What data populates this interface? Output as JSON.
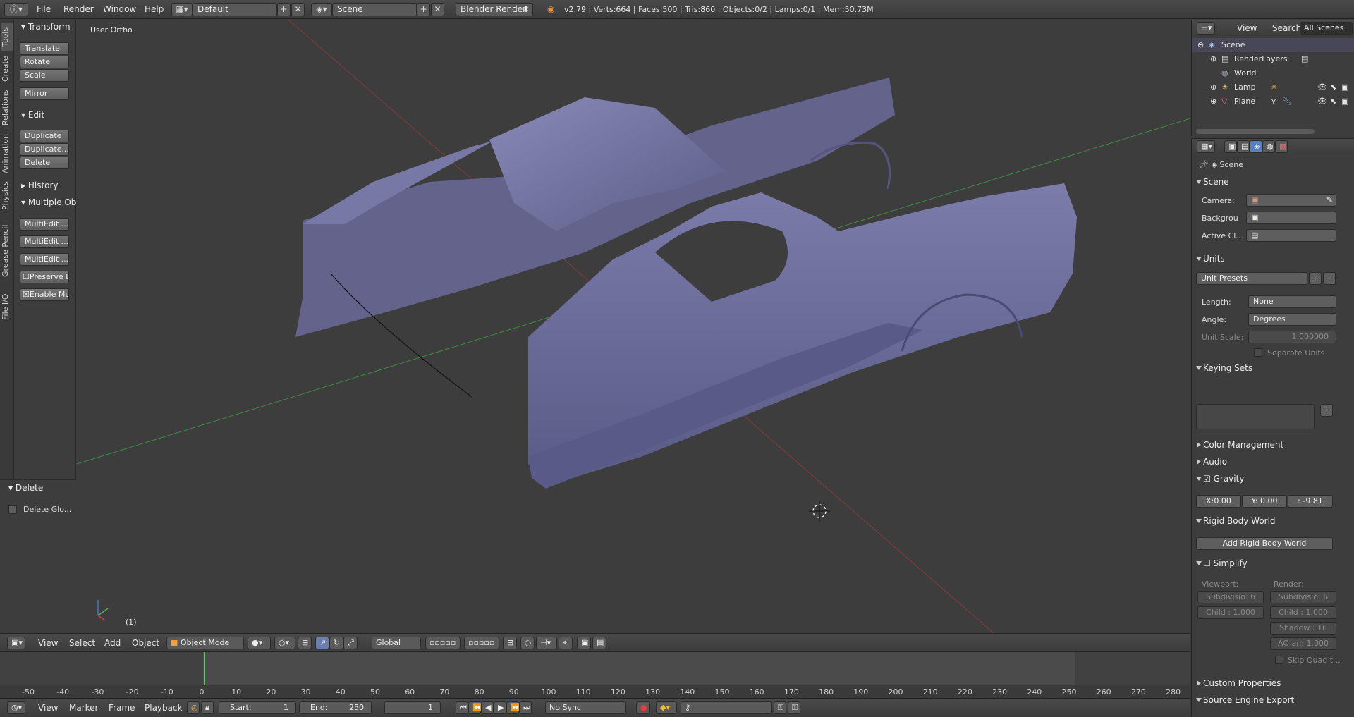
{
  "topbar": {
    "menus": [
      "File",
      "Render",
      "Window",
      "Help"
    ],
    "screen_layout": "Default",
    "scene": "Scene",
    "render_engine": "Blender Render",
    "stats": "v2.79 | Verts:664 | Faces:500 | Tris:860 | Objects:0/2 | Lamps:0/1 | Mem:50.73M"
  },
  "tool_tabs": [
    "Tools",
    "Create",
    "Relations",
    "Animation",
    "Physics",
    "Grease Pencil",
    "File I/O"
  ],
  "toolshelf": {
    "transform_title": "Transform",
    "transform_buttons": [
      "Translate",
      "Rotate",
      "Scale",
      "Mirror"
    ],
    "edit_title": "Edit",
    "edit_buttons": [
      "Duplicate",
      "Duplicate...",
      "Delete"
    ],
    "history_title": "History",
    "multi_title": "Multiple.Ob",
    "multi_buttons": [
      "MultiEdit ...",
      "MultiEdit ...",
      "MultiEdit ..."
    ],
    "preserve_label": "Preserve L",
    "enable_label": "Enable Mu"
  },
  "operator": {
    "title": "Delete",
    "option": "Delete Glo..."
  },
  "viewport": {
    "view_name": "User Ortho",
    "frame_label": "(1)"
  },
  "view3d_header": {
    "menus": [
      "View",
      "Select",
      "Add",
      "Object"
    ],
    "mode": "Object Mode",
    "orientation": "Global"
  },
  "timeline": {
    "ticks": [
      "-50",
      "-40",
      "-30",
      "-20",
      "-10",
      "0",
      "10",
      "20",
      "30",
      "40",
      "50",
      "60",
      "70",
      "80",
      "90",
      "100",
      "110",
      "120",
      "130",
      "140",
      "150",
      "160",
      "170",
      "180",
      "190",
      "200",
      "210",
      "220",
      "230",
      "240",
      "250",
      "260",
      "270",
      "280"
    ],
    "menus": [
      "View",
      "Marker",
      "Frame",
      "Playback"
    ],
    "start_label": "Start:",
    "start_value": "1",
    "end_label": "End:",
    "end_value": "250",
    "current_frame": "1",
    "sync": "No Sync"
  },
  "outliner": {
    "menus": [
      "View",
      "Search"
    ],
    "filter": "All Scenes",
    "items": [
      {
        "label": "Scene",
        "icon": "scene-icon"
      },
      {
        "label": "RenderLayers",
        "icon": "renderlayers-icon"
      },
      {
        "label": "World",
        "icon": "world-icon"
      },
      {
        "label": "Lamp",
        "icon": "lamp-icon"
      },
      {
        "label": "Plane",
        "icon": "mesh-icon"
      }
    ]
  },
  "properties": {
    "context": "Scene",
    "scene_panel": "Scene",
    "camera_label": "Camera:",
    "background_label": "Backgrou",
    "active_clip_label": "Active Cl...",
    "units_panel": "Units",
    "unit_presets": "Unit Presets",
    "length_label": "Length:",
    "length_value": "None",
    "angle_label": "Angle:",
    "angle_value": "Degrees",
    "unit_scale_label": "Unit Scale:",
    "unit_scale_value": "1.000000",
    "separate_units": "Separate Units",
    "keying_sets_panel": "Keying Sets",
    "color_mgmt_panel": "Color Management",
    "audio_panel": "Audio",
    "gravity_panel": "Gravity",
    "gravity_x": "X:0.00",
    "gravity_y": "Y: 0.00",
    "gravity_z": ": -9.81",
    "rigid_body_panel": "Rigid Body World",
    "add_rigid_body": "Add Rigid Body World",
    "simplify_panel": "Simplify",
    "viewport_label": "Viewport:",
    "render_label": "Render:",
    "subdiv_vp": "Subdivisio: 6",
    "subdiv_r": "Subdivisio: 6",
    "child_vp": "Child : 1.000",
    "child_r": "Child : 1.000",
    "shadow_r": "Shadow : 16",
    "ao_r": "AO an: 1.000",
    "skip_quad": "Skip Quad t...",
    "custom_props_panel": "Custom Properties",
    "source_engine_panel": "Source Engine Export"
  }
}
